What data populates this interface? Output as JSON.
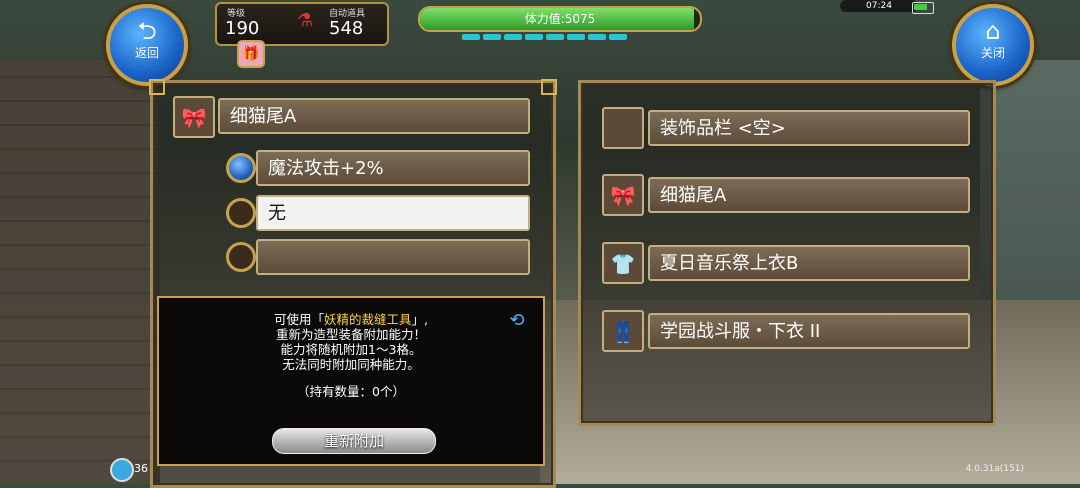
{
  "hud": {
    "back_label": "返回",
    "close_label": "关闭",
    "level_caption": "等级",
    "level_value": "190",
    "auto_item_caption": "自动道具",
    "auto_item_value": "548",
    "stamina_label": "体力值:5075",
    "stamina_fraction": 0.98,
    "clock": "07:24",
    "chat_count": "36",
    "version": "4.0.31a(151)"
  },
  "item_panel": {
    "item_name": "细猫尾A",
    "abilities": [
      {
        "text": "魔法攻击+2%"
      },
      {
        "text": "无"
      },
      {
        "text": ""
      }
    ]
  },
  "info": {
    "line1_prefix": "可使用「",
    "line1_highlight": "妖精的裁缝工具",
    "line1_suffix": "」,",
    "line2": "重新为造型装备附加能力！",
    "line3": "能力将随机附加1～3格。",
    "line4": "无法同时附加同种能力。",
    "count": "（持有数量：0个）",
    "button": "重新附加"
  },
  "equip_list": [
    {
      "label": "装饰品栏 <空>",
      "icon": "empty-slot"
    },
    {
      "label": "细猫尾A",
      "icon": "bow-icon"
    },
    {
      "label": "夏日音乐祭上衣B",
      "icon": "shirt-icon"
    },
    {
      "label": "学园战斗服・下衣 II",
      "icon": "pants-icon"
    }
  ]
}
